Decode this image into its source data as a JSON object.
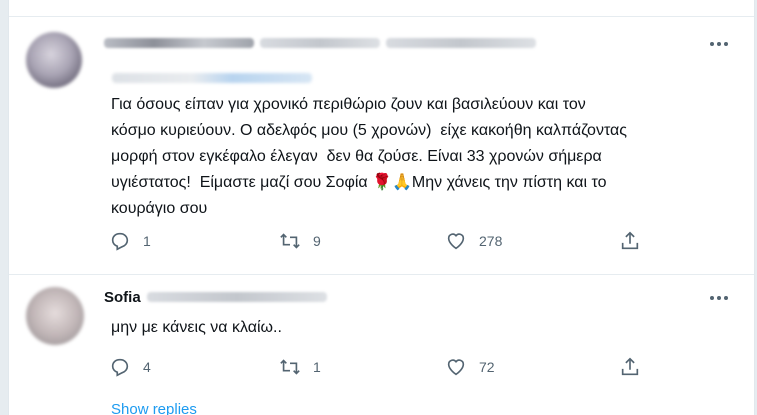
{
  "tweets": [
    {
      "text": "Για όσους είπαν για χρονικό περιθώριο ζουν και βασιλεύουν και τον\nκόσμο κυριεύουν. Ο αδελφός μου (5 χρονών)  είχε κακοήθη καλπάζοντας\nμορφή στον εγκέφαλο έλεγαν  δεν θα ζούσε. Είναι 33 χρονών σήμερα\nυγιέστατος!  Είμαστε μαζί σου Σοφία 🌹🙏Μην χάνεις την πίστη και το\nκουράγιο σου",
      "counts": {
        "replies": "1",
        "retweets": "9",
        "likes": "278"
      }
    },
    {
      "display_name": "Sofia",
      "text": "μην με κάνεις να κλαίω..",
      "counts": {
        "replies": "4",
        "retweets": "1",
        "likes": "72"
      },
      "show_replies": "Show replies"
    }
  ],
  "icons": {
    "more": "more-horizontal-icon",
    "reply": "reply-icon",
    "retweet": "retweet-icon",
    "like": "heart-icon",
    "share": "share-icon"
  },
  "colors": {
    "accent": "#1d9bf0",
    "secondary_text": "#536471",
    "background": "#e6ecf0"
  }
}
